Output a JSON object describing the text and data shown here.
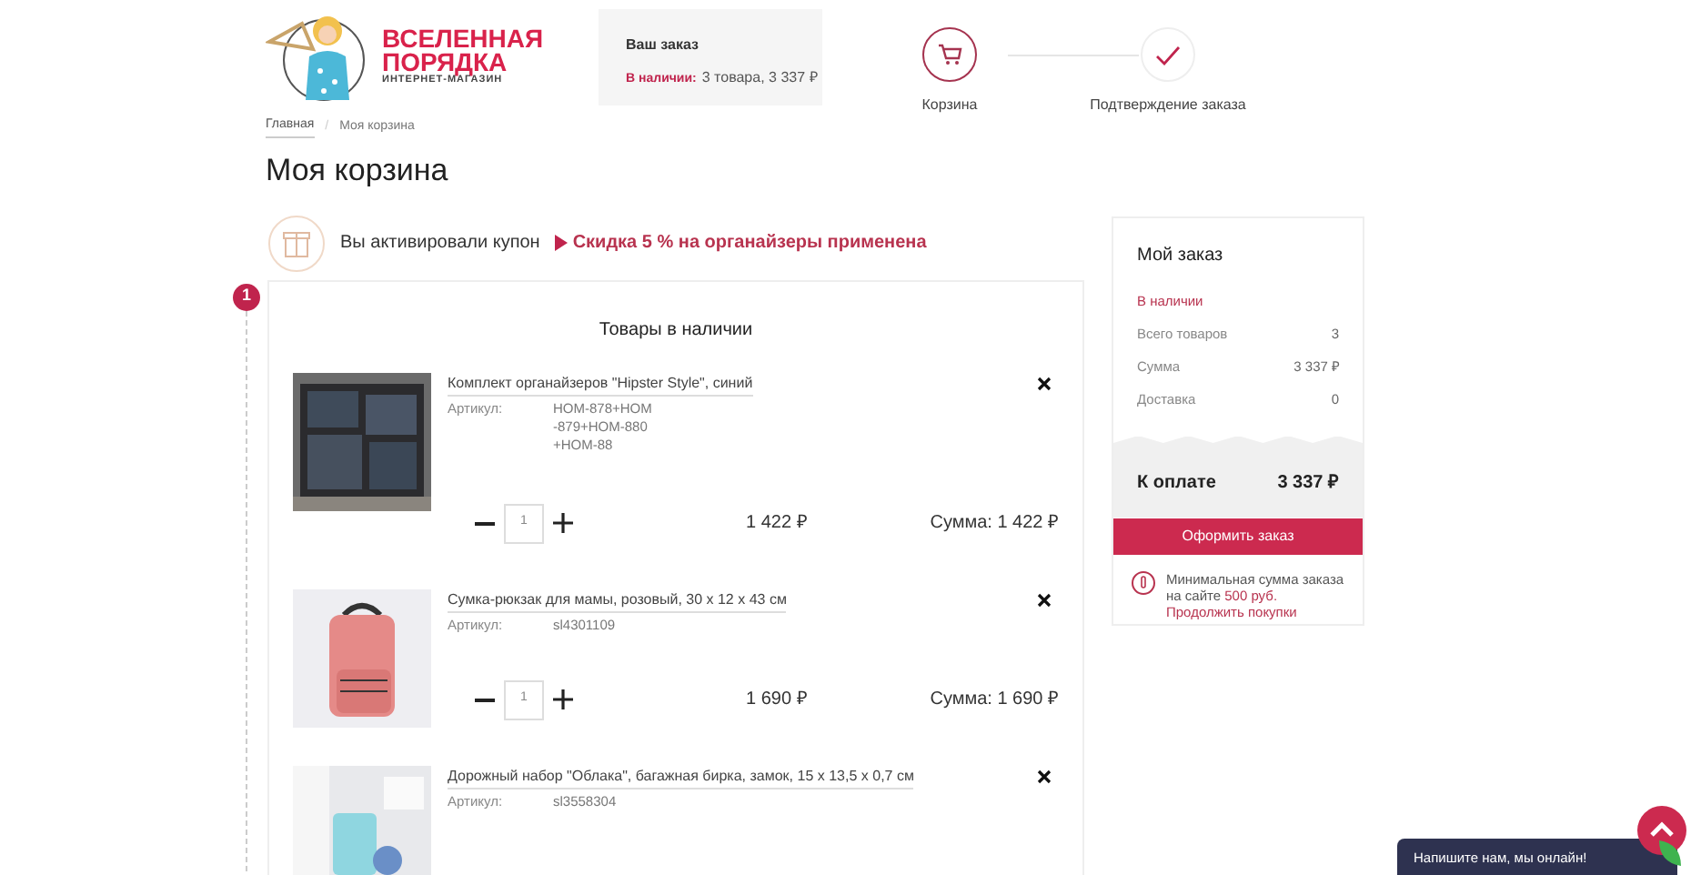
{
  "logo": {
    "line1": "ВСЕЛЕННАЯ",
    "line2": "ПОРЯДКА",
    "tagline": "ИНТЕРНЕТ-МАГАЗИН"
  },
  "order_box": {
    "title": "Ваш заказ",
    "label": "В наличии:",
    "value": "3 товара, 3 337 ₽"
  },
  "steps": [
    {
      "label": "Корзина",
      "kind": "cart",
      "selected": true
    },
    {
      "label": "Подтверждение заказа",
      "kind": "check",
      "selected": false
    }
  ],
  "breadcrumbs": [
    {
      "label": "Главная"
    },
    {
      "label": "Моя корзина"
    }
  ],
  "breadcrumb_separator": "/",
  "page_title": "Моя корзина",
  "coupon": {
    "text": "Вы активировали купон",
    "link": "Скидка 5 % на органайзеры применена"
  },
  "section": {
    "number": "1",
    "title": "Товары в наличии",
    "items": [
      {
        "name": "Комплект органайзеров \"Hipster Style\", синий",
        "article_label": "Артикул:",
        "article": "HOM-878+HOM-879+HOM-880+HOM-88",
        "quantity": "1",
        "price": "1 422 ₽",
        "total": "Сумма: 1 422 ₽"
      },
      {
        "name": "Сумка-рюкзак для мамы, розовый, 30 х 12 х 43 см",
        "article_label": "Артикул:",
        "article": "sl4301109",
        "quantity": "1",
        "price": "1 690 ₽",
        "total": "Сумма: 1 690 ₽"
      },
      {
        "name": "Дорожный набор \"Облака\", багажная бирка, замок, 15 х 13,5 х 0,7 см",
        "article_label": "Артикул:",
        "article": "sl3558304"
      }
    ]
  },
  "summary": {
    "title": "Мой заказ",
    "group": "В наличии",
    "rows": [
      {
        "label": "Всего товаров",
        "value": "3"
      },
      {
        "label": "Сумма",
        "value": "3 337 ₽"
      },
      {
        "label": "Доставка",
        "value": "0"
      }
    ],
    "pay_label": "К оплате",
    "pay_value": "3 337 ₽",
    "button": "Оформить заказ",
    "note": "Минимальная сумма заказа на сайте",
    "note_amount": "500 руб.",
    "continue": "Продолжить покупки"
  },
  "chat": {
    "text": "Напишите нам, мы онлайн!"
  }
}
